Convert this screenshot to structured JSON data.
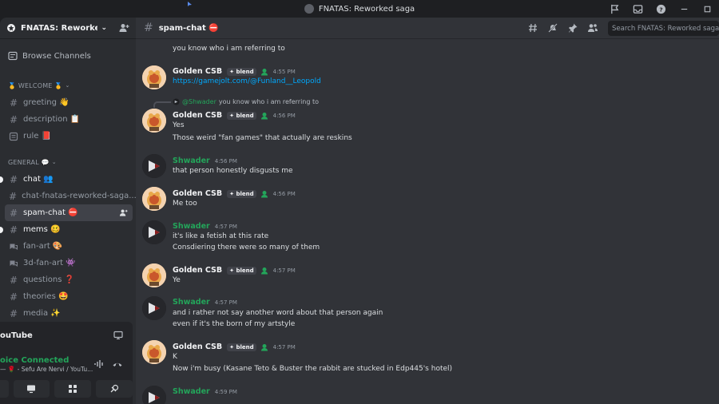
{
  "window": {
    "title": "FNATAS: Reworked saga"
  },
  "server": {
    "name": "FNATAS: Reworked..."
  },
  "sidebar": {
    "browse_label": "Browse Channels",
    "categories": [
      {
        "label": "🥇 WELCOME 🥇"
      },
      {
        "label": "GENERAL 💬"
      }
    ],
    "channels": [
      {
        "label": "greeting 👋"
      },
      {
        "label": "description 📋"
      },
      {
        "label": "rule 📕"
      },
      {
        "label": "chat 👥"
      },
      {
        "label": "chat-fnatas-reworked-saga..."
      },
      {
        "label": "spam-chat ⛔"
      },
      {
        "label": "mems 🥴"
      },
      {
        "label": "fan-art 🎨"
      },
      {
        "label": "3d-fan-art 👾"
      },
      {
        "label": "questions ❓"
      },
      {
        "label": "theories 🤩"
      },
      {
        "label": "media ✨"
      }
    ]
  },
  "activity": {
    "label": "ouTube"
  },
  "voice": {
    "status": "oice Connected",
    "sub": "— 🌹 - Sefu Are Nervi / YouTu..."
  },
  "header": {
    "channel": "spam-chat ⛔",
    "search_placeholder": "Search FNATAS: Reworked saga"
  },
  "messages": {
    "top_line": "you know who i am referring to",
    "m1": {
      "author": "Golden CSB",
      "tag": "blend",
      "time": "4:55 PM",
      "text": "https://gamejolt.com/@Funland__Leopold"
    },
    "reply": {
      "mention": "@Shwader",
      "text": "you know who i am referring to"
    },
    "m2": {
      "author": "Golden CSB",
      "tag": "blend",
      "time": "4:56 PM",
      "lines": [
        "Yes",
        "Those weird \"fan games\" that actually are reskins"
      ]
    },
    "m3": {
      "author": "Shwader",
      "time": "4:56 PM",
      "text": "that person honestly disgusts me"
    },
    "m4": {
      "author": "Golden CSB",
      "tag": "blend",
      "time": "4:56 PM",
      "text": "Me too"
    },
    "m5": {
      "author": "Shwader",
      "time": "4:57 PM",
      "lines": [
        "it's like a fetish at this rate",
        "Consdiering there were so many of them"
      ]
    },
    "m6": {
      "author": "Golden CSB",
      "tag": "blend",
      "time": "4:57 PM",
      "text": "Ye"
    },
    "m7": {
      "author": "Shwader",
      "time": "4:57 PM",
      "lines": [
        "and i rather not say another word about that person again",
        "even if it's the born of my artstyle"
      ]
    },
    "m8": {
      "author": "Golden CSB",
      "tag": "blend",
      "time": "4:57 PM",
      "lines": [
        "K",
        "Now i'm busy (Kasane Teto & Buster the rabbit are stucked in Edp445's hotel)"
      ]
    },
    "m9": {
      "author": "Shwader",
      "time": "4:59 PM"
    }
  },
  "colors": {
    "accent_green": "#23a55a",
    "link": "#00a8fc",
    "bg": "#313338",
    "sidebar": "#2b2d31"
  }
}
